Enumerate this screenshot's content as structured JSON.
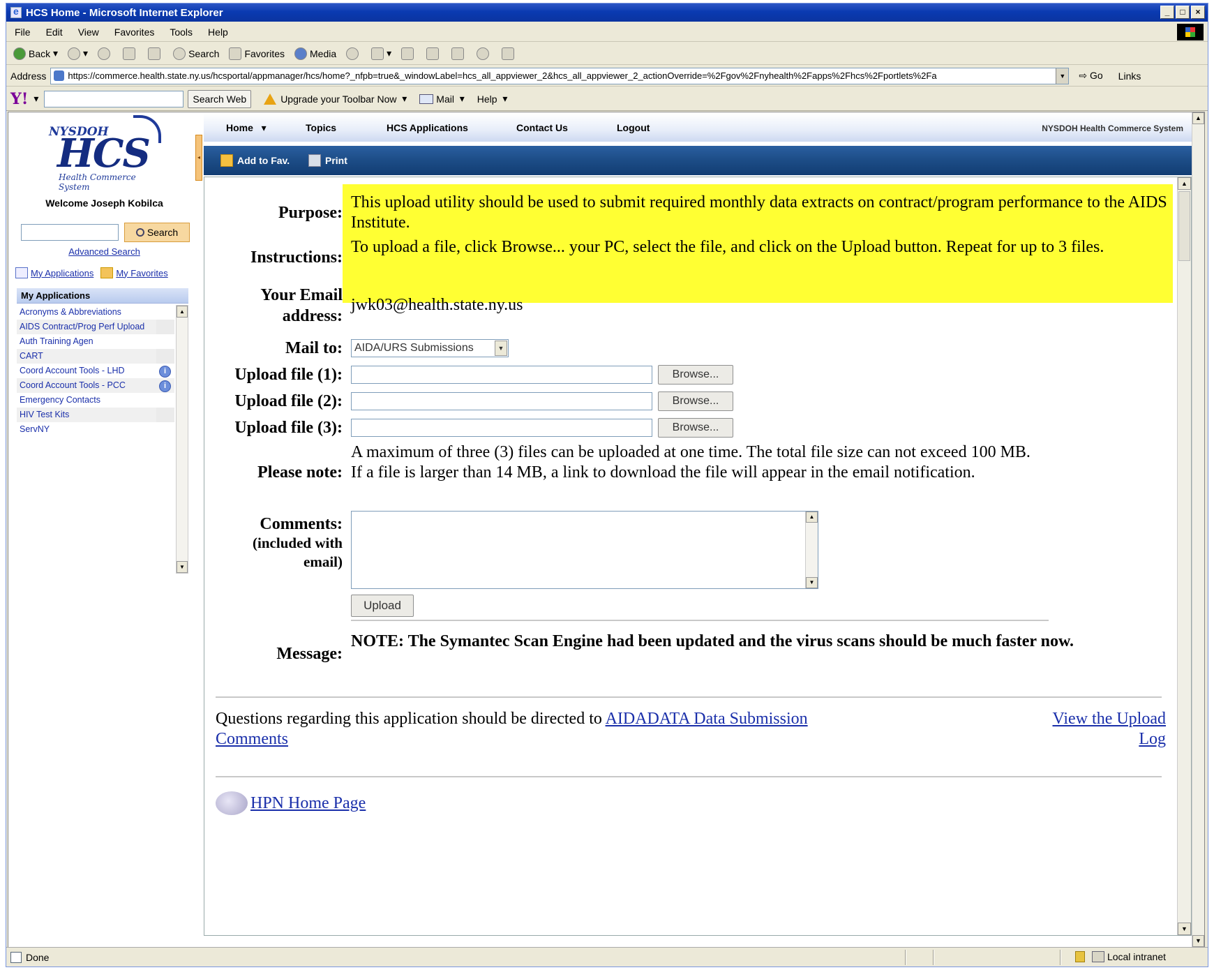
{
  "window": {
    "title": "HCS Home - Microsoft Internet Explorer",
    "controls": [
      "_",
      "□",
      "×"
    ]
  },
  "menu": [
    "File",
    "Edit",
    "View",
    "Favorites",
    "Tools",
    "Help"
  ],
  "toolbar": {
    "back": "Back",
    "search": "Search",
    "favorites": "Favorites",
    "media": "Media"
  },
  "address": {
    "label": "Address",
    "url": "https://commerce.health.state.ny.us/hcsportal/appmanager/hcs/home?_nfpb=true&_windowLabel=hcs_all_appviewer_2&hcs_all_appviewer_2_actionOverride=%2Fgov%2Fnyhealth%2Fapps%2Fhcs%2Fportlets%2Fa",
    "go": "Go",
    "links": "Links"
  },
  "yahoo": {
    "logo": "Y!",
    "search_btn": "Search Web",
    "upgrade": "Upgrade your Toolbar Now",
    "mail": "Mail",
    "help": "Help"
  },
  "sidebar": {
    "logo_top": "NYSDOH",
    "logo_main": "HCS",
    "logo_sub": "Health Commerce System",
    "welcome": "Welcome Joseph Kobilca",
    "search_btn": "Search",
    "advanced": "Advanced Search",
    "my_apps_link": "My Applications",
    "my_favs_link": "My Favorites",
    "apps_header": "My Applications",
    "apps": [
      "Acronyms & Abbreviations",
      "AIDS Contract/Prog Perf Upload",
      "Auth Training Agen",
      "CART",
      "Coord Account Tools - LHD",
      "Coord Account Tools - PCC",
      "Emergency Contacts",
      "HIV Test Kits",
      "ServNY"
    ]
  },
  "nav": {
    "home": "Home",
    "topics": "Topics",
    "hcs_apps": "HCS Applications",
    "contact": "Contact Us",
    "logout": "Logout",
    "brand": "NYSDOH Health Commerce System",
    "add_fav": "Add to Fav.",
    "print": "Print"
  },
  "form": {
    "purpose_label": "Purpose:",
    "purpose_text": "This upload utility should be used to submit required monthly data extracts on contract/program performance to the AIDS Institute.",
    "instructions_label": "Instructions:",
    "instructions_text": "To upload a file, click Browse... your PC, select the file, and click on the Upload button. Repeat for up to 3 files.",
    "email_label_1": "Your Email",
    "email_label_2": "address:",
    "email_value": "jwk03@health.state.ny.us",
    "mailto_label": "Mail to:",
    "mailto_value": "AIDA/URS Submissions",
    "upload1_label": "Upload file (1):",
    "upload2_label": "Upload file (2):",
    "upload3_label": "Upload file (3):",
    "browse": "Browse...",
    "note_label": "Please note:",
    "note_text_1": "A maximum of three (3) files can be uploaded at one time. The total file size can not exceed 100 MB.",
    "note_text_2": "If a file is larger than 14 MB, a link to download the file will appear in the email notification.",
    "comments_label_1": "Comments:",
    "comments_label_2": "(included with",
    "comments_label_3": "email)",
    "upload_btn": "Upload",
    "message_label": "Message:",
    "message_text": "NOTE: The Symantec Scan Engine had been updated and the virus scans should be much faster now."
  },
  "footer": {
    "questions": "Questions regarding this application should be directed to ",
    "link": "AIDADATA Data Submission Comments",
    "view_log": "View the Upload Log",
    "hpn": "HPN Home Page"
  },
  "status": {
    "done": "Done",
    "zone": "Local intranet"
  }
}
